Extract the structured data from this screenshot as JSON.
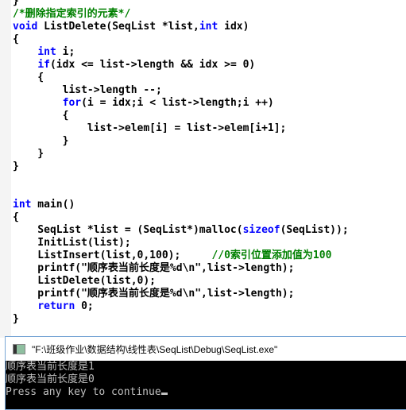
{
  "editor": {
    "lines": [
      [
        {
          "t": "}",
          "c": ""
        }
      ],
      [
        {
          "t": "/*删除指定索引的元素*/",
          "c": "cm"
        }
      ],
      [
        {
          "t": "void",
          "c": "kw"
        },
        {
          "t": " ListDelete(SeqList *list,",
          "c": ""
        },
        {
          "t": "int",
          "c": "kw"
        },
        {
          "t": " idx)",
          "c": ""
        }
      ],
      [
        {
          "t": "{",
          "c": ""
        }
      ],
      [
        {
          "t": "    ",
          "c": ""
        },
        {
          "t": "int",
          "c": "kw"
        },
        {
          "t": " i;",
          "c": ""
        }
      ],
      [
        {
          "t": "    ",
          "c": ""
        },
        {
          "t": "if",
          "c": "kw"
        },
        {
          "t": "(idx <= list->length && idx >= 0)",
          "c": ""
        }
      ],
      [
        {
          "t": "    {",
          "c": ""
        }
      ],
      [
        {
          "t": "        list->length --;",
          "c": ""
        }
      ],
      [
        {
          "t": "        ",
          "c": ""
        },
        {
          "t": "for",
          "c": "kw"
        },
        {
          "t": "(i = idx;i < list->length;i ++)",
          "c": ""
        }
      ],
      [
        {
          "t": "        {",
          "c": ""
        }
      ],
      [
        {
          "t": "            list->elem[i] = list->elem[i+1];",
          "c": ""
        }
      ],
      [
        {
          "t": "        }",
          "c": ""
        }
      ],
      [
        {
          "t": "    }",
          "c": ""
        }
      ],
      [
        {
          "t": "}",
          "c": ""
        }
      ],
      [],
      [],
      [
        {
          "t": "int",
          "c": "kw"
        },
        {
          "t": " main()",
          "c": ""
        }
      ],
      [
        {
          "t": "{",
          "c": ""
        }
      ],
      [
        {
          "t": "    SeqList *list = (SeqList*)malloc(",
          "c": ""
        },
        {
          "t": "sizeof",
          "c": "kw"
        },
        {
          "t": "(SeqList));",
          "c": ""
        }
      ],
      [
        {
          "t": "    InitList(list);",
          "c": ""
        }
      ],
      [
        {
          "t": "    ListInsert(list,0,100);     ",
          "c": ""
        },
        {
          "t": "//0索引位置添加值为100",
          "c": "cm"
        }
      ],
      [
        {
          "t": "    printf(\"顺序表当前长度是%d\\n\",list->length);",
          "c": ""
        }
      ],
      [
        {
          "t": "    ListDelete(list,0);",
          "c": ""
        }
      ],
      [
        {
          "t": "    printf(\"顺序表当前长度是%d\\n\",list->length);",
          "c": ""
        }
      ],
      [
        {
          "t": "    ",
          "c": ""
        },
        {
          "t": "return",
          "c": "kw"
        },
        {
          "t": " 0;",
          "c": ""
        }
      ],
      [
        {
          "t": "}",
          "c": ""
        }
      ]
    ]
  },
  "console": {
    "title": "\"F:\\班级作业\\数据结构\\线性表\\SeqList\\Debug\\SeqList.exe\"",
    "output": [
      "顺序表当前长度是1",
      "顺序表当前长度是0",
      "Press any key to continue"
    ]
  },
  "colors": {
    "keyword": "#0000ff",
    "comment": "#008000",
    "console_bg": "#000000",
    "console_text": "#c0c0c0"
  }
}
